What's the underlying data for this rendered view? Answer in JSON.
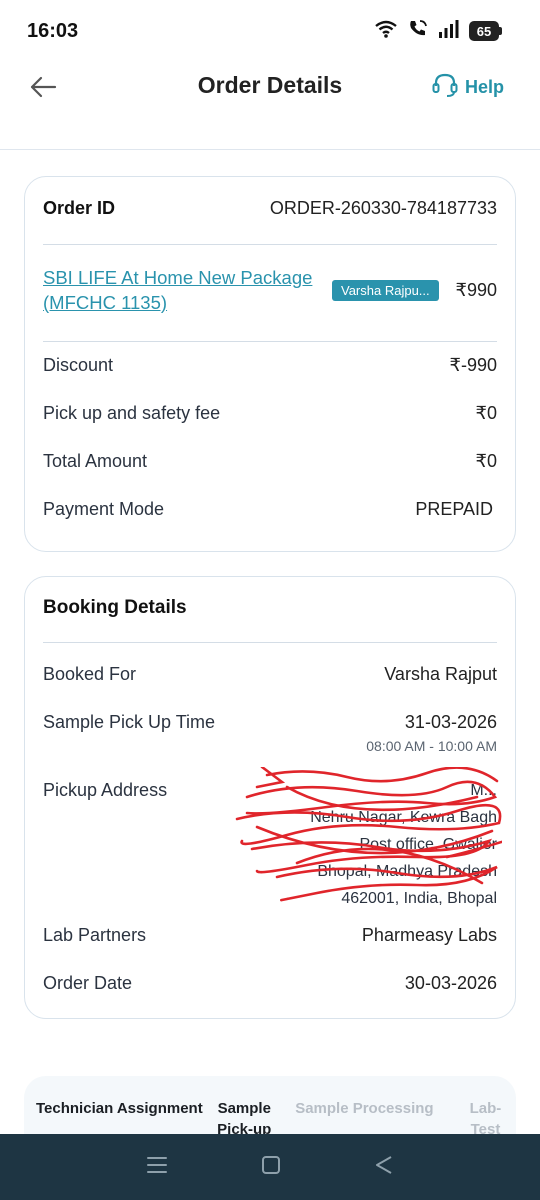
{
  "status_bar": {
    "time": "16:03",
    "battery": "65",
    "icons": [
      "wifi-icon",
      "wifi-call-icon",
      "signal-icon",
      "battery-icon"
    ]
  },
  "header": {
    "title": "Order Details",
    "help_label": "Help",
    "back_icon": "arrow-left-icon",
    "help_icon": "headset-icon"
  },
  "order_card": {
    "order_id_label": "Order ID",
    "order_id_value": "ORDER-260330-784187733",
    "package_name": "SBI LIFE At Home New Package (MFCHC 1135)",
    "patient_badge": "Varsha Rajpu...",
    "package_price": "₹990",
    "rows": [
      {
        "label": "Discount",
        "value": "₹-990"
      },
      {
        "label": "Pick up and safety fee",
        "value": "₹0"
      },
      {
        "label": "Total Amount",
        "value": "₹0"
      },
      {
        "label": "Payment Mode",
        "value": "PREPAID"
      }
    ]
  },
  "booking_card": {
    "title": "Booking Details",
    "booked_for_label": "Booked For",
    "booked_for_value": "Varsha Rajput",
    "pickup_time_label": "Sample Pick Up Time",
    "pickup_date": "31-03-2026",
    "pickup_slot": "08:00 AM - 10:00 AM",
    "pickup_address_label": "Pickup Address",
    "pickup_address_lines": [
      "M...",
      "Nehru Nagar, Kewra Bagh",
      "Post office, Gwalior",
      "Bhopal, Madhya Pradesh",
      "462001, India, Bhopal"
    ],
    "lab_partners_label": "Lab Partners",
    "lab_partners_value": "Pharmeasy Labs",
    "order_date_label": "Order Date",
    "order_date_value": "30-03-2026"
  },
  "progress": {
    "steps": [
      {
        "label": "Technician Assignment",
        "state": "active"
      },
      {
        "label": "Sample Pick-up",
        "state": "active"
      },
      {
        "label": "Sample Processing",
        "state": "inactive"
      },
      {
        "label": "Lab-Test Report",
        "state": "inactive"
      }
    ]
  },
  "colors": {
    "accent": "#2a93ad",
    "nav_bg": "#1e3543",
    "scribble": "#e0252b"
  },
  "nav": {
    "icons": [
      "menu-icon",
      "home-square-icon",
      "back-triangle-icon"
    ]
  }
}
